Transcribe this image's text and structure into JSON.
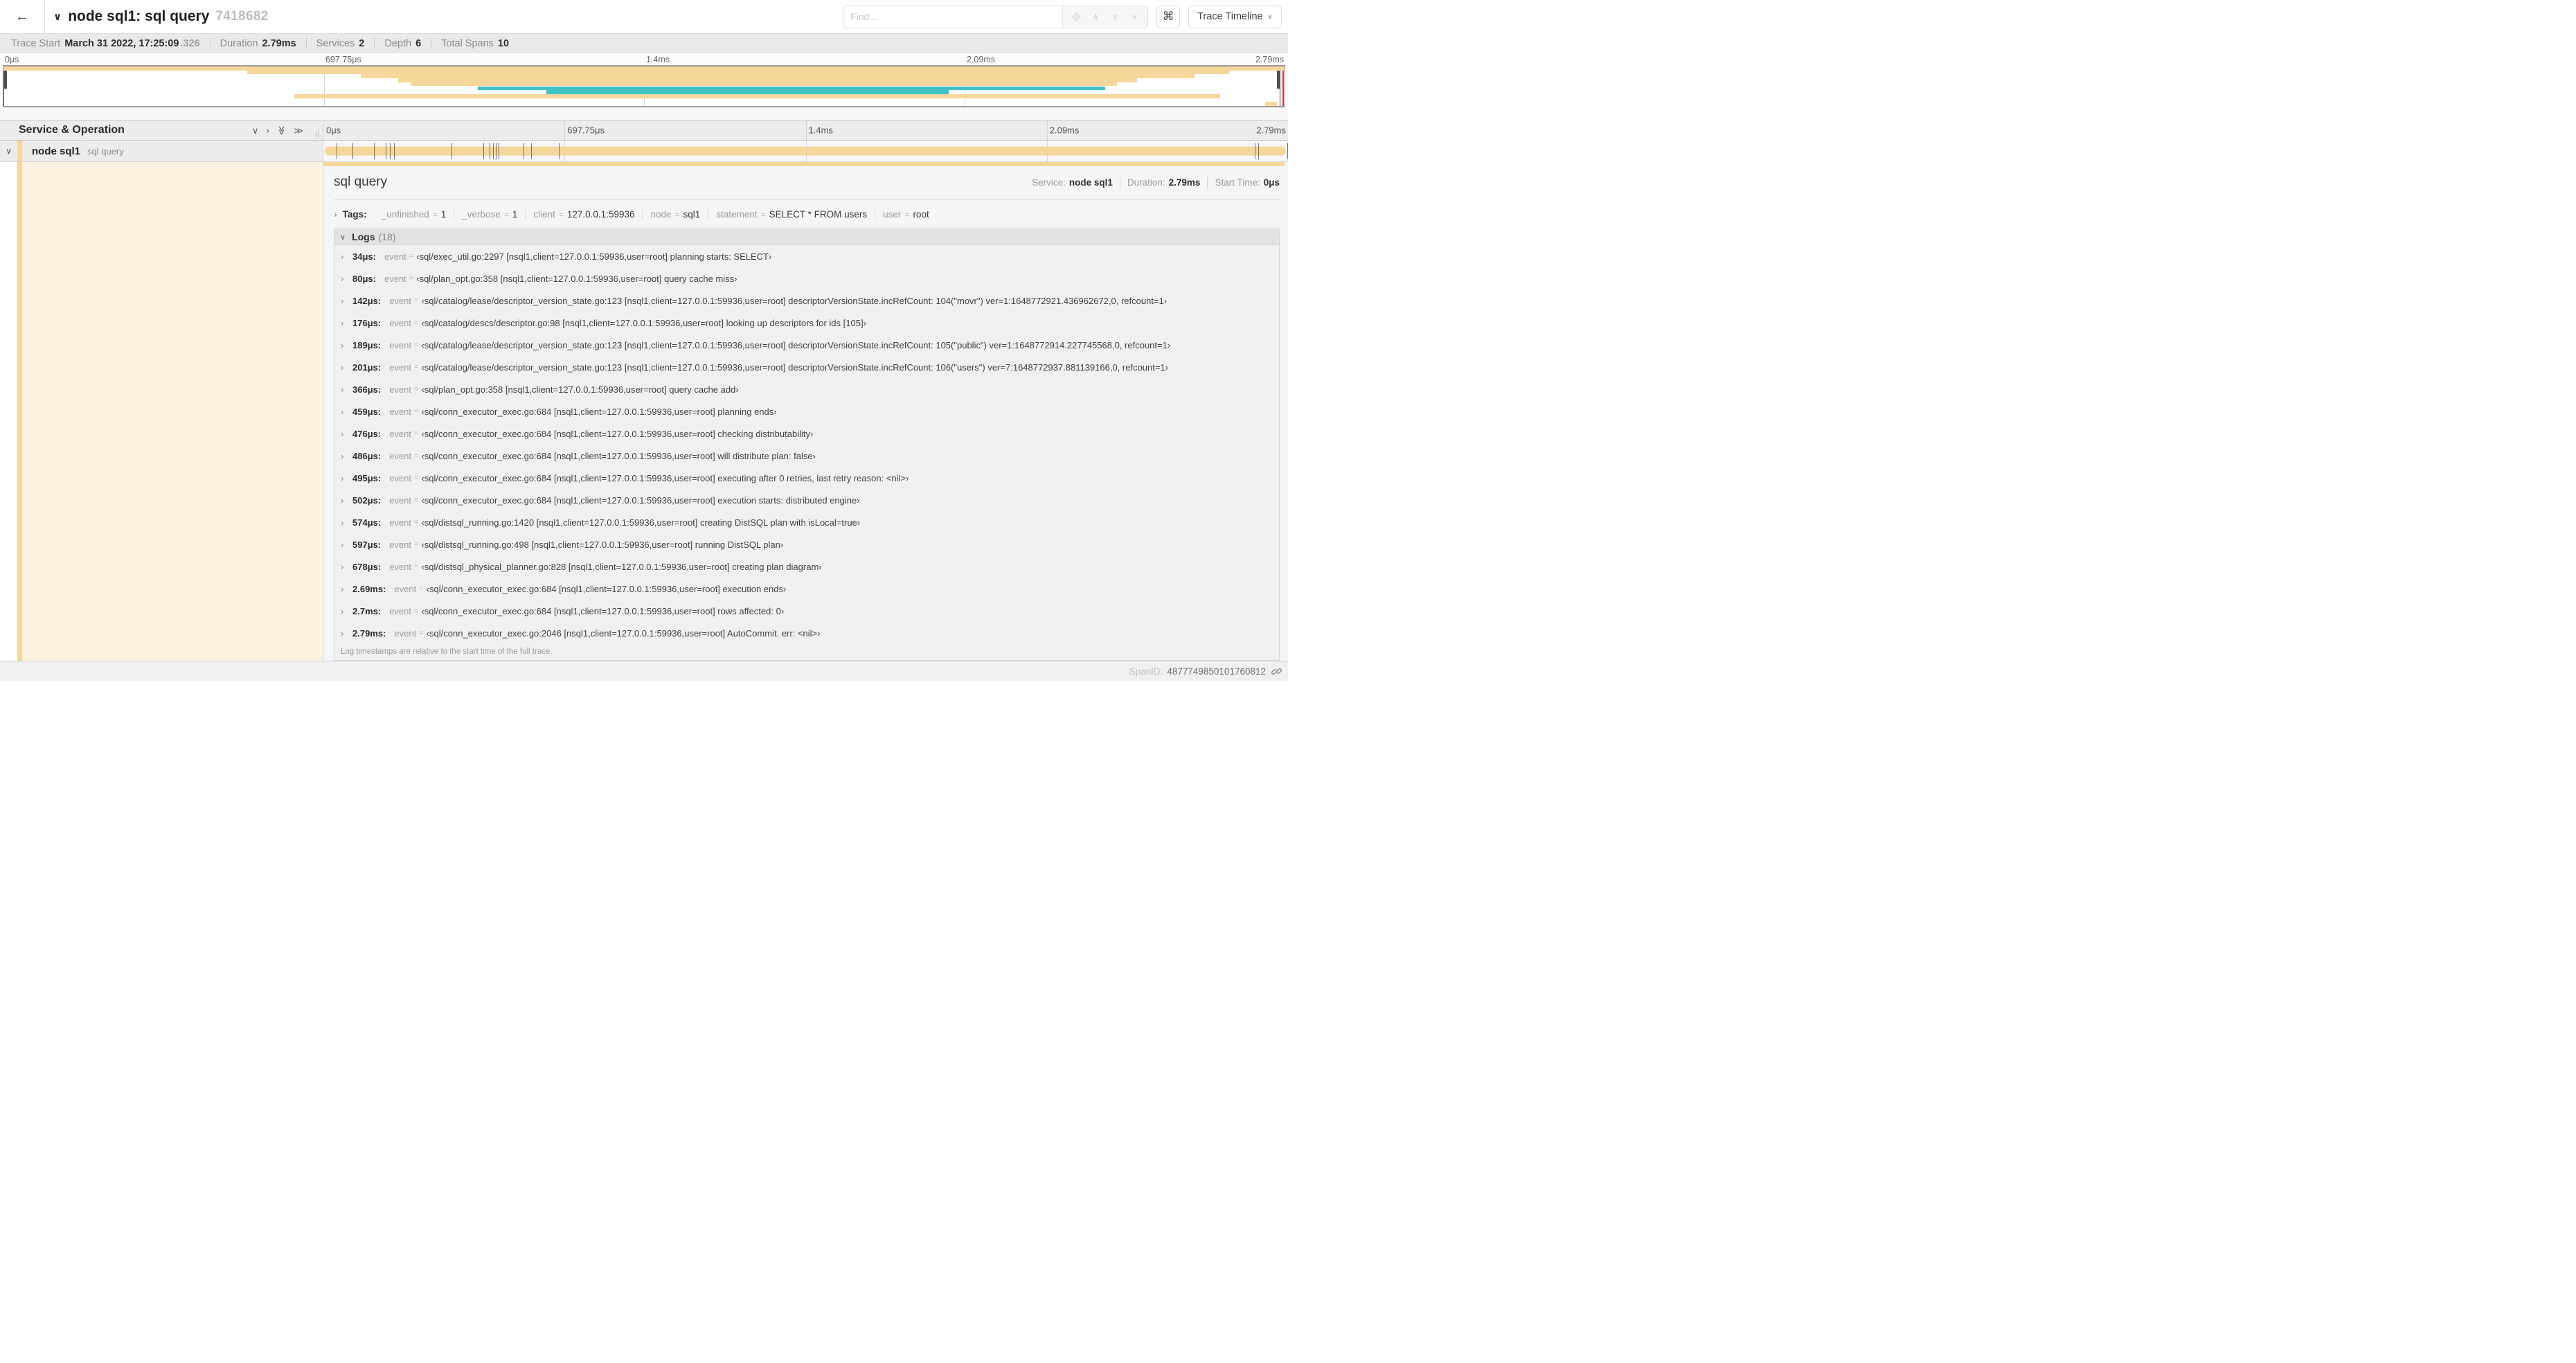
{
  "header": {
    "trace_title": "node sql1: sql query",
    "trace_id": "7418682",
    "find_placeholder": "Find...",
    "shortcut_key": "⌘",
    "view_select_label": "Trace Timeline",
    "glyphs": {
      "back": "←",
      "chevron_down": "∨",
      "chevron_up": "∧",
      "chevron_right": "›",
      "double_chevron_right": "≫",
      "close": "×"
    }
  },
  "summary": {
    "items": [
      {
        "label": "Trace Start",
        "value": "March 31 2022, 17:25:09",
        "suffix": ".326"
      },
      {
        "label": "Duration",
        "value": "2.79ms",
        "suffix": ""
      },
      {
        "label": "Services",
        "value": "2",
        "suffix": ""
      },
      {
        "label": "Depth",
        "value": "6",
        "suffix": ""
      },
      {
        "label": "Total Spans",
        "value": "10",
        "suffix": ""
      }
    ]
  },
  "minimap": {
    "ticks": [
      {
        "label": "0μs",
        "pct": 0
      },
      {
        "label": "697.75μs",
        "pct": 25
      },
      {
        "label": "1.4ms",
        "pct": 50
      },
      {
        "label": "2.09ms",
        "pct": 75
      },
      {
        "label": "2.79ms",
        "pct": 100
      }
    ],
    "spans": [
      {
        "row": 0,
        "start": 0,
        "end": 100,
        "color": "tan"
      },
      {
        "row": 1,
        "start": 19,
        "end": 95.7,
        "color": "tan"
      },
      {
        "row": 2,
        "start": 27.9,
        "end": 93,
        "color": "tan"
      },
      {
        "row": 3,
        "start": 30.8,
        "end": 88.5,
        "color": "tan"
      },
      {
        "row": 4,
        "start": 31.8,
        "end": 86.9,
        "color": "tan"
      },
      {
        "row": 5,
        "start": 37,
        "end": 86,
        "color": "teal"
      },
      {
        "row": 6,
        "start": 42.4,
        "end": 73.8,
        "color": "teal"
      },
      {
        "row": 7,
        "start": 22.7,
        "end": 95,
        "color": "tan"
      },
      {
        "row": 9,
        "start": 98.5,
        "end": 99.4,
        "color": "tan"
      }
    ],
    "colors": {
      "tan": "#f6d79b",
      "teal": "#41c0c5",
      "cursor_guide": "#d63a36"
    }
  },
  "timeline": {
    "column_header": "Service & Operation",
    "row": {
      "service": "node sql1",
      "operation": "sql query"
    },
    "log_marker_pcts": [
      1.22,
      2.87,
      5.09,
      6.31,
      6.77,
      7.2,
      13.12,
      16.45,
      17.06,
      17.42,
      17.74,
      17.99,
      20.57,
      21.4,
      24.3,
      96.42,
      96.77,
      99.8
    ]
  },
  "detail": {
    "title": "sql query",
    "meta": [
      {
        "label": "Service:",
        "value": "node sql1"
      },
      {
        "label": "Duration:",
        "value": "2.79ms"
      },
      {
        "label": "Start Time:",
        "value": "0μs"
      }
    ],
    "tags_label": "Tags:",
    "tags": [
      {
        "key": "_unfinished",
        "value": "1"
      },
      {
        "key": "_verbose",
        "value": "1"
      },
      {
        "key": "client",
        "value": "127.0.0.1:59936"
      },
      {
        "key": "node",
        "value": "sql1"
      },
      {
        "key": "statement",
        "value": "SELECT * FROM users"
      },
      {
        "key": "user",
        "value": "root"
      }
    ],
    "logs": {
      "label": "Logs",
      "count": "(18)",
      "entries": [
        {
          "time": "34μs:",
          "key": "event",
          "value": "‹sql/exec_util.go:2297 [nsql1,client=127.0.0.1:59936,user=root] planning starts: SELECT›"
        },
        {
          "time": "80μs:",
          "key": "event",
          "value": "‹sql/plan_opt.go:358 [nsql1,client=127.0.0.1:59936,user=root] query cache miss›"
        },
        {
          "time": "142μs:",
          "key": "event",
          "value": "‹sql/catalog/lease/descriptor_version_state.go:123 [nsql1,client=127.0.0.1:59936,user=root] descriptorVersionState.incRefCount: 104(\"movr\") ver=1:1648772921.436962672,0, refcount=1›"
        },
        {
          "time": "176μs:",
          "key": "event",
          "value": "‹sql/catalog/descs/descriptor.go:98 [nsql1,client=127.0.0.1:59936,user=root] looking up descriptors for ids [105]›"
        },
        {
          "time": "189μs:",
          "key": "event",
          "value": "‹sql/catalog/lease/descriptor_version_state.go:123 [nsql1,client=127.0.0.1:59936,user=root] descriptorVersionState.incRefCount: 105(\"public\") ver=1:1648772914.227745568,0, refcount=1›"
        },
        {
          "time": "201μs:",
          "key": "event",
          "value": "‹sql/catalog/lease/descriptor_version_state.go:123 [nsql1,client=127.0.0.1:59936,user=root] descriptorVersionState.incRefCount: 106(\"users\") ver=7:1648772937.881139166,0, refcount=1›"
        },
        {
          "time": "366μs:",
          "key": "event",
          "value": "‹sql/plan_opt.go:358 [nsql1,client=127.0.0.1:59936,user=root] query cache add›"
        },
        {
          "time": "459μs:",
          "key": "event",
          "value": "‹sql/conn_executor_exec.go:684 [nsql1,client=127.0.0.1:59936,user=root] planning ends›"
        },
        {
          "time": "476μs:",
          "key": "event",
          "value": "‹sql/conn_executor_exec.go:684 [nsql1,client=127.0.0.1:59936,user=root] checking distributability›"
        },
        {
          "time": "486μs:",
          "key": "event",
          "value": "‹sql/conn_executor_exec.go:684 [nsql1,client=127.0.0.1:59936,user=root] will distribute plan: false›"
        },
        {
          "time": "495μs:",
          "key": "event",
          "value": "‹sql/conn_executor_exec.go:684 [nsql1,client=127.0.0.1:59936,user=root] executing after 0 retries, last retry reason: <nil>›"
        },
        {
          "time": "502μs:",
          "key": "event",
          "value": "‹sql/conn_executor_exec.go:684 [nsql1,client=127.0.0.1:59936,user=root] execution starts: distributed engine›"
        },
        {
          "time": "574μs:",
          "key": "event",
          "value": "‹sql/distsql_running.go:1420 [nsql1,client=127.0.0.1:59936,user=root] creating DistSQL plan with isLocal=true›"
        },
        {
          "time": "597μs:",
          "key": "event",
          "value": "‹sql/distsql_running.go:498 [nsql1,client=127.0.0.1:59936,user=root] running DistSQL plan›"
        },
        {
          "time": "678μs:",
          "key": "event",
          "value": "‹sql/distsql_physical_planner.go:828 [nsql1,client=127.0.0.1:59936,user=root] creating plan diagram›"
        },
        {
          "time": "2.69ms:",
          "key": "event",
          "value": "‹sql/conn_executor_exec.go:684 [nsql1,client=127.0.0.1:59936,user=root] execution ends›"
        },
        {
          "time": "2.7ms:",
          "key": "event",
          "value": "‹sql/conn_executor_exec.go:684 [nsql1,client=127.0.0.1:59936,user=root] rows affected: 0›"
        },
        {
          "time": "2.79ms:",
          "key": "event",
          "value": "‹sql/conn_executor_exec.go:2046 [nsql1,client=127.0.0.1:59936,user=root] AutoCommit. err: <nil>›"
        }
      ],
      "note": "Log timestamps are relative to the start time of the full trace."
    },
    "span_id_label": "SpanID:",
    "span_id": "4877749850101760812"
  }
}
